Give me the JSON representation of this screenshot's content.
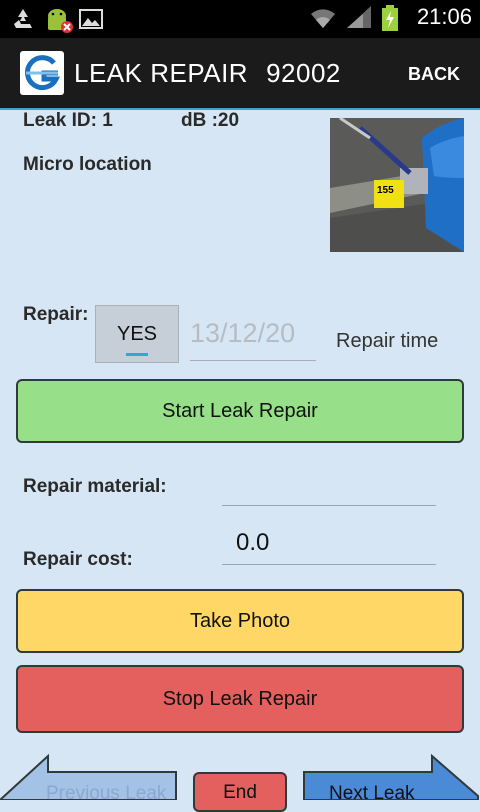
{
  "statusbar": {
    "time": "21:06"
  },
  "header": {
    "title": "LEAK REPAIR",
    "code": "92002",
    "back_label": "BACK"
  },
  "leak": {
    "id_label": "Leak ID: 1",
    "db_label": "dB :20",
    "micro_location_label": "Micro location"
  },
  "repair": {
    "label": "Repair:",
    "yes_label": "YES",
    "date_value": "13/12/20",
    "repair_time_label": "Repair time",
    "start_button": "Start Leak Repair",
    "material_label": "Repair material:",
    "material_value": "",
    "cost_label": "Repair cost:",
    "cost_value": "0.0",
    "take_photo_button": "Take Photo",
    "stop_button": "Stop Leak Repair"
  },
  "nav": {
    "previous_label": "Previous Leak",
    "end_label": "End",
    "next_label": "Next Leak"
  },
  "colors": {
    "background": "#d6e6f5",
    "actionbar": "#1b1b1b",
    "accent": "#33a6d8",
    "start_green": "#98df8a",
    "photo_yellow": "#ffd766",
    "stop_red": "#e4605f",
    "nav_blue": "#4b8ad6"
  },
  "icons": [
    "recycle-icon",
    "android-debug-icon",
    "image-icon",
    "wifi-icon",
    "signal-icon",
    "battery-charging-icon",
    "app-logo-icon"
  ]
}
